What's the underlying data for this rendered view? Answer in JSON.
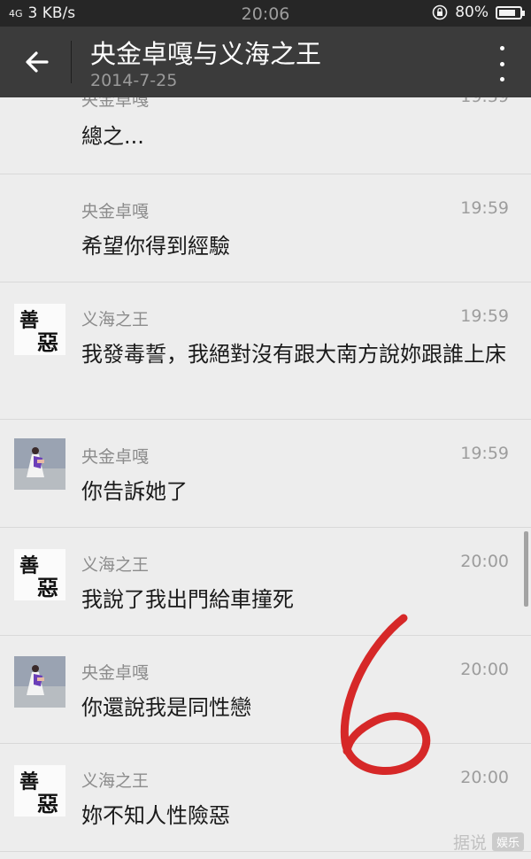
{
  "status_bar": {
    "signal": "4G",
    "network_speed": "3 KB/s",
    "time": "20:06",
    "battery": "80%",
    "battery_level": 0.8
  },
  "header": {
    "title": "央金卓嘎与义海之王",
    "subtitle": "2014-7-25",
    "back_icon": "arrow-left-icon",
    "more_icon": "more-vertical-icon"
  },
  "messages": [
    {
      "sender": "央金卓嘎",
      "time": "19:59",
      "text": "總之..."
    },
    {
      "sender": "央金卓嘎",
      "time": "19:59",
      "text": "希望你得到經驗"
    },
    {
      "sender": "义海之王",
      "time": "19:59",
      "text": "我發毒誓，我絕對沒有跟大南方說妳跟誰上床"
    },
    {
      "sender": "央金卓嘎",
      "time": "19:59",
      "text": "你告訴她了"
    },
    {
      "sender": "义海之王",
      "time": "20:00",
      "text": "我說了我出門給車撞死"
    },
    {
      "sender": "央金卓嘎",
      "time": "20:00",
      "text": "你還說我是同性戀"
    },
    {
      "sender": "义海之王",
      "time": "20:00",
      "text": "妳不知人性險惡"
    }
  ],
  "avatar_glyphs": {
    "top": "善",
    "bottom": "惡"
  },
  "watermark": {
    "text": "据说",
    "badge": "娱乐"
  },
  "colors": {
    "status_bar": "#262626",
    "header": "#3b3b3b",
    "background": "#ededed",
    "annotation": "#d62828"
  }
}
